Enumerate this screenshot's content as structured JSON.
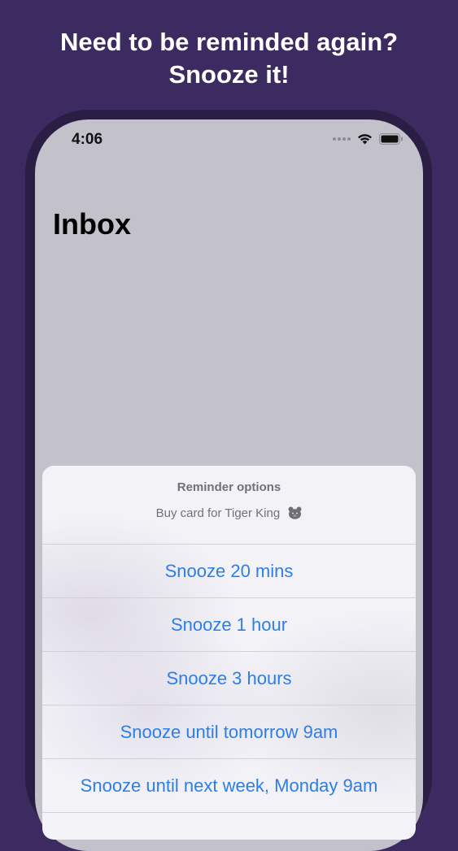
{
  "headline": {
    "line1": "Need to be reminded again?",
    "line2": "Snooze it!"
  },
  "status_bar": {
    "time": "4:06"
  },
  "screen": {
    "title": "Inbox"
  },
  "action_sheet": {
    "title": "Reminder options",
    "message": "Buy card for Tiger King",
    "options": [
      {
        "label": "Snooze 20 mins"
      },
      {
        "label": "Snooze 1 hour"
      },
      {
        "label": "Snooze 3 hours"
      },
      {
        "label": "Snooze until tomorrow 9am"
      },
      {
        "label": "Snooze until next week, Monday 9am"
      }
    ]
  },
  "colors": {
    "background": "#3b2b60",
    "option_text": "#2c7ee8",
    "sheet_bg": "#f3f2f7",
    "dimmed_screen": "#c3c2cb"
  },
  "icons": [
    "signal-dots-icon",
    "wifi-icon",
    "battery-icon",
    "bear-face-icon"
  ]
}
